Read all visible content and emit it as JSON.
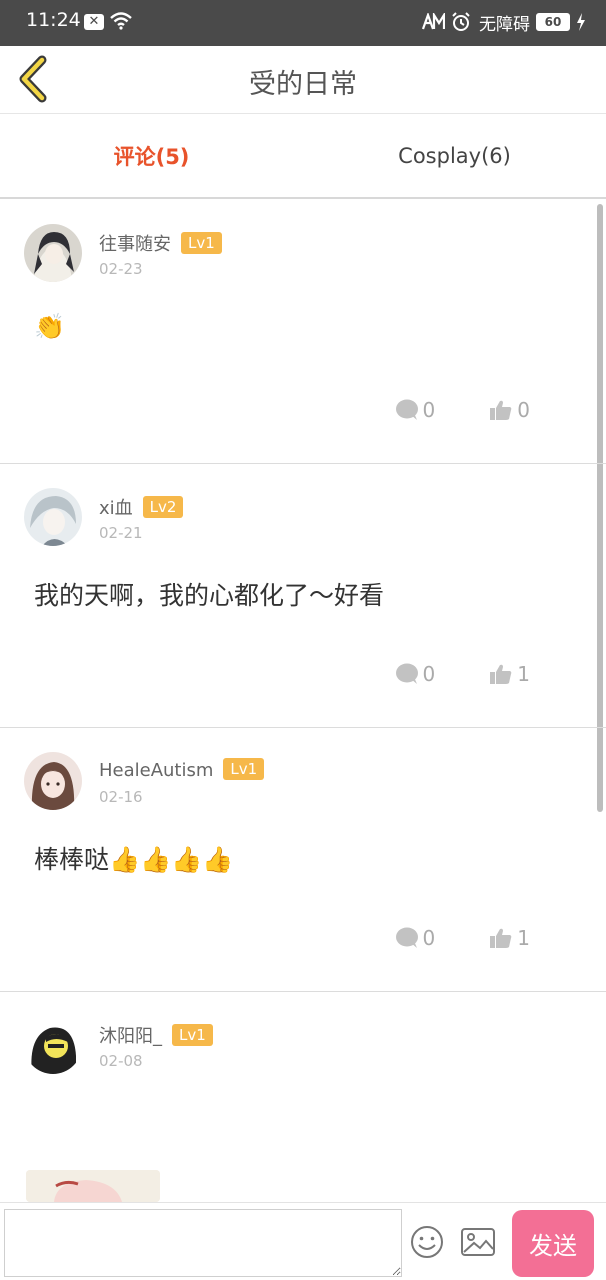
{
  "status_bar": {
    "time": "11:24",
    "accessibility": "无障碍",
    "battery": "60"
  },
  "header": {
    "title": "受的日常"
  },
  "tabs": [
    {
      "label": "评论(5)",
      "active": true
    },
    {
      "label": "Cosplay(6)",
      "active": false
    }
  ],
  "comments": [
    {
      "username": "往事随安",
      "level": "Lv1",
      "date": "02-23",
      "content": "👏",
      "replies": "0",
      "likes": "0"
    },
    {
      "username": "xi血",
      "level": "Lv2",
      "date": "02-21",
      "content": "我的天啊，我的心都化了～好看",
      "replies": "0",
      "likes": "1"
    },
    {
      "username": "HealeAutism",
      "level": "Lv1",
      "date": "02-16",
      "content": "棒棒哒👍👍👍👍",
      "replies": "0",
      "likes": "1"
    },
    {
      "username": "沐阳阳_",
      "level": "Lv1",
      "date": "02-08",
      "content": "",
      "replies": "",
      "likes": ""
    }
  ],
  "input": {
    "placeholder": "",
    "send_label": "发送"
  },
  "colors": {
    "active_tab": "#e8532b",
    "level_badge": "#f6b84a",
    "send_button": "#f36f95",
    "status_bar": "#4a4a4a"
  }
}
